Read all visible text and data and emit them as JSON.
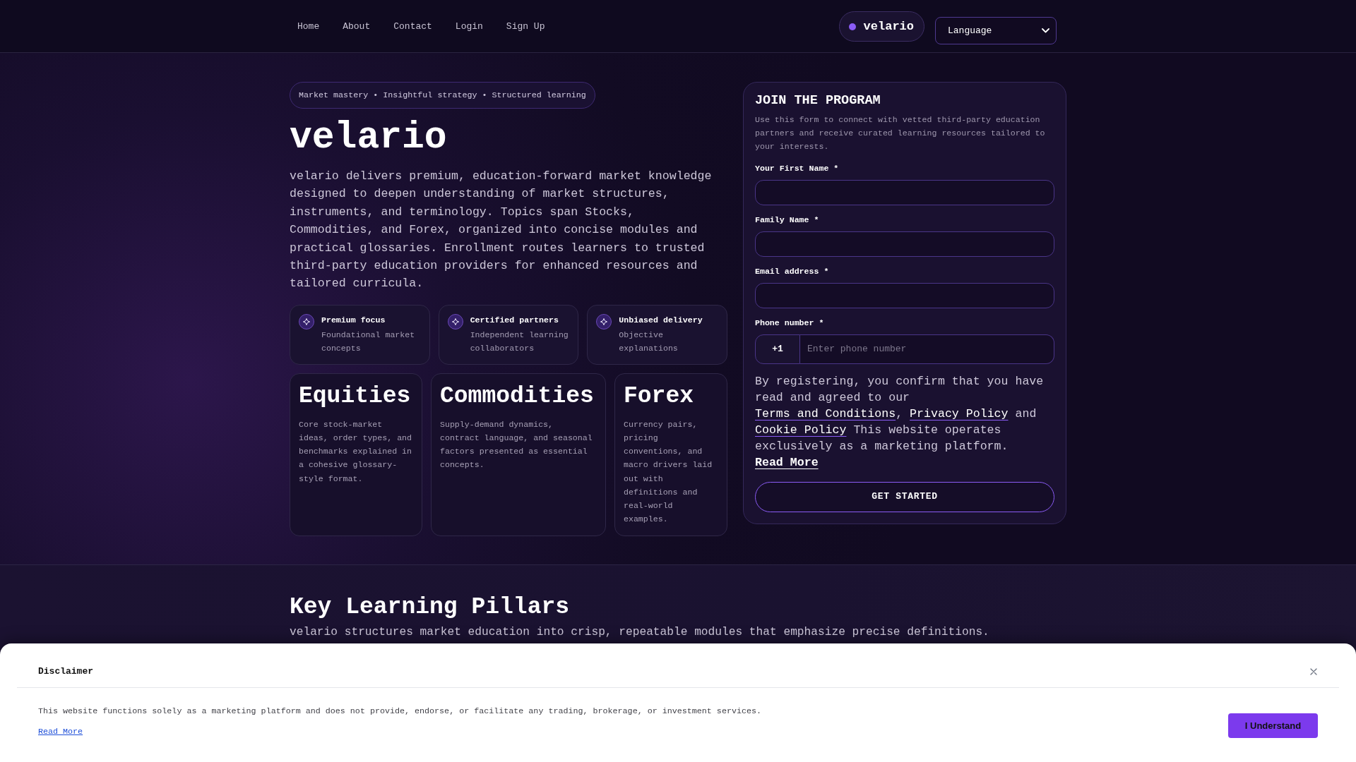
{
  "nav": {
    "links": [
      "Home",
      "About",
      "Contact",
      "Login",
      "Sign Up"
    ],
    "brand": "velario",
    "language_select": {
      "value": "Language"
    }
  },
  "hero": {
    "tagline": "Market mastery • Insightful strategy • Structured learning",
    "title": "velario",
    "description": "velario delivers premium, education-forward market knowledge designed to deepen understanding of market structures, instruments, and terminology. Topics span Stocks, Commodities, and Forex, organized into concise modules and practical glossaries. Enrollment routes learners to trusted third-party education providers for enhanced resources and tailored curricula.",
    "features": [
      {
        "title": "Premium focus",
        "description": "Foundational market concepts"
      },
      {
        "title": "Certified partners",
        "description": "Independent learning collaborators"
      },
      {
        "title": "Unbiased delivery",
        "description": "Objective explanations"
      }
    ],
    "topics": [
      {
        "title": "Equities",
        "description": "Core stock-market ideas, order types, and benchmarks explained in a cohesive glossary-style format."
      },
      {
        "title": "Commodities",
        "description": "Supply-demand dynamics, contract language, and seasonal factors presented as essential concepts."
      },
      {
        "title": "Forex",
        "description": "Currency pairs, pricing conventions, and macro drivers laid out with definitions and real-world examples."
      }
    ]
  },
  "signup_form": {
    "title": "JOIN THE PROGRAM",
    "description": "Use this form to connect with vetted third-party education partners and receive curated learning resources tailored to your interests.",
    "fields": [
      {
        "kind": "text",
        "label": "Your First Name *"
      },
      {
        "kind": "text",
        "label": "Family Name *"
      },
      {
        "kind": "text",
        "label": "Email address *"
      },
      {
        "kind": "phone",
        "label": "Phone number *",
        "prefix": "+1",
        "placeholder": "Enter phone number"
      }
    ],
    "consent": [
      {
        "kind": "text",
        "text": "By registering, you confirm that you have read and agreed to our "
      },
      {
        "kind": "link",
        "text": "Terms and Conditions"
      },
      {
        "kind": "text",
        "text": ", "
      },
      {
        "kind": "link",
        "text": "Privacy Policy"
      },
      {
        "kind": "text",
        "text": " and "
      },
      {
        "kind": "link",
        "text": "Cookie Policy"
      },
      {
        "kind": "text",
        "text": " This website operates exclusively as a marketing platform. "
      },
      {
        "kind": "strong_link",
        "text": "Read More"
      }
    ],
    "submit": "GET STARTED"
  },
  "pillars": {
    "title": "Key Learning Pillars",
    "description": "velario structures market education into crisp, repeatable modules that emphasize precise definitions."
  },
  "disclaimer": {
    "title": "Disclaimer",
    "text": "This website functions solely as a marketing platform and does not provide, endorse, or facilitate any trading, brokerage, or investment services.",
    "link": "Read More",
    "button": "I Understand"
  }
}
